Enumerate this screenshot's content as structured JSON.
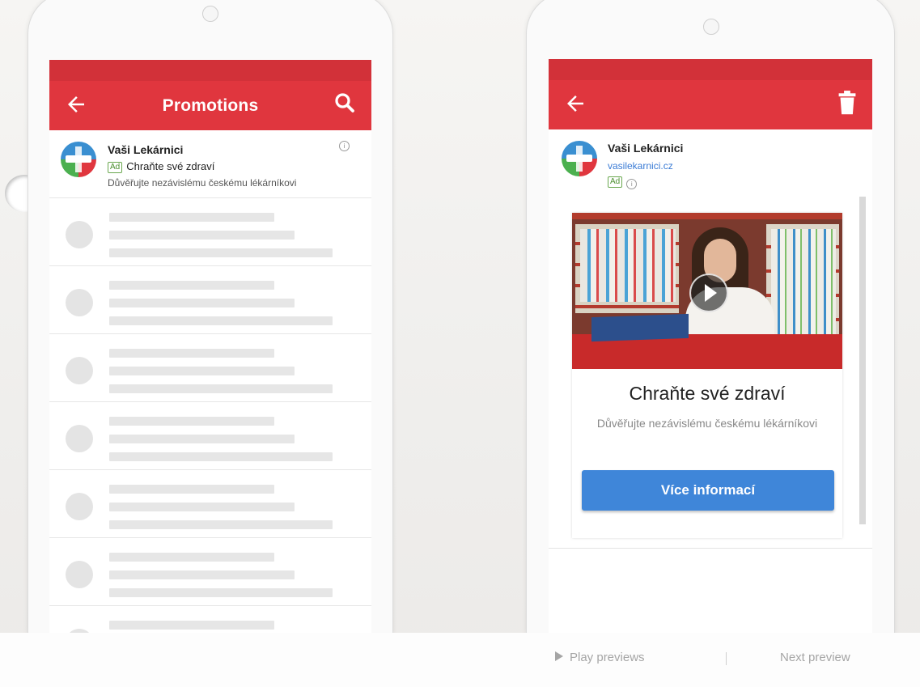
{
  "left_phone": {
    "header": {
      "title": "Promotions",
      "back_icon": "arrow-back-icon",
      "search_icon": "search-icon",
      "bar_color": "#e0363e"
    },
    "ad": {
      "sender": "Vaši Lekárnici",
      "badge": "Ad",
      "subject": "Chraňte své zdraví",
      "snippet": "Důvěřujte nezávislému českému lékárníkovi",
      "info_icon": "info-icon"
    },
    "placeholder_rows": 6
  },
  "right_phone": {
    "header": {
      "back_icon": "arrow-back-icon",
      "trash_icon": "trash-icon"
    },
    "sender": "Vaši Lekárnici",
    "url": "vasilekarnici.cz",
    "badge": "Ad",
    "card": {
      "title": "Chraňte své zdraví",
      "description": "Důvěřujte nezávislému českému lékárníkovi",
      "cta_label": "Více informací",
      "cta_color": "#3f86d9"
    }
  },
  "footer": {
    "play_label": "Play previews",
    "next_label": "Next preview"
  }
}
